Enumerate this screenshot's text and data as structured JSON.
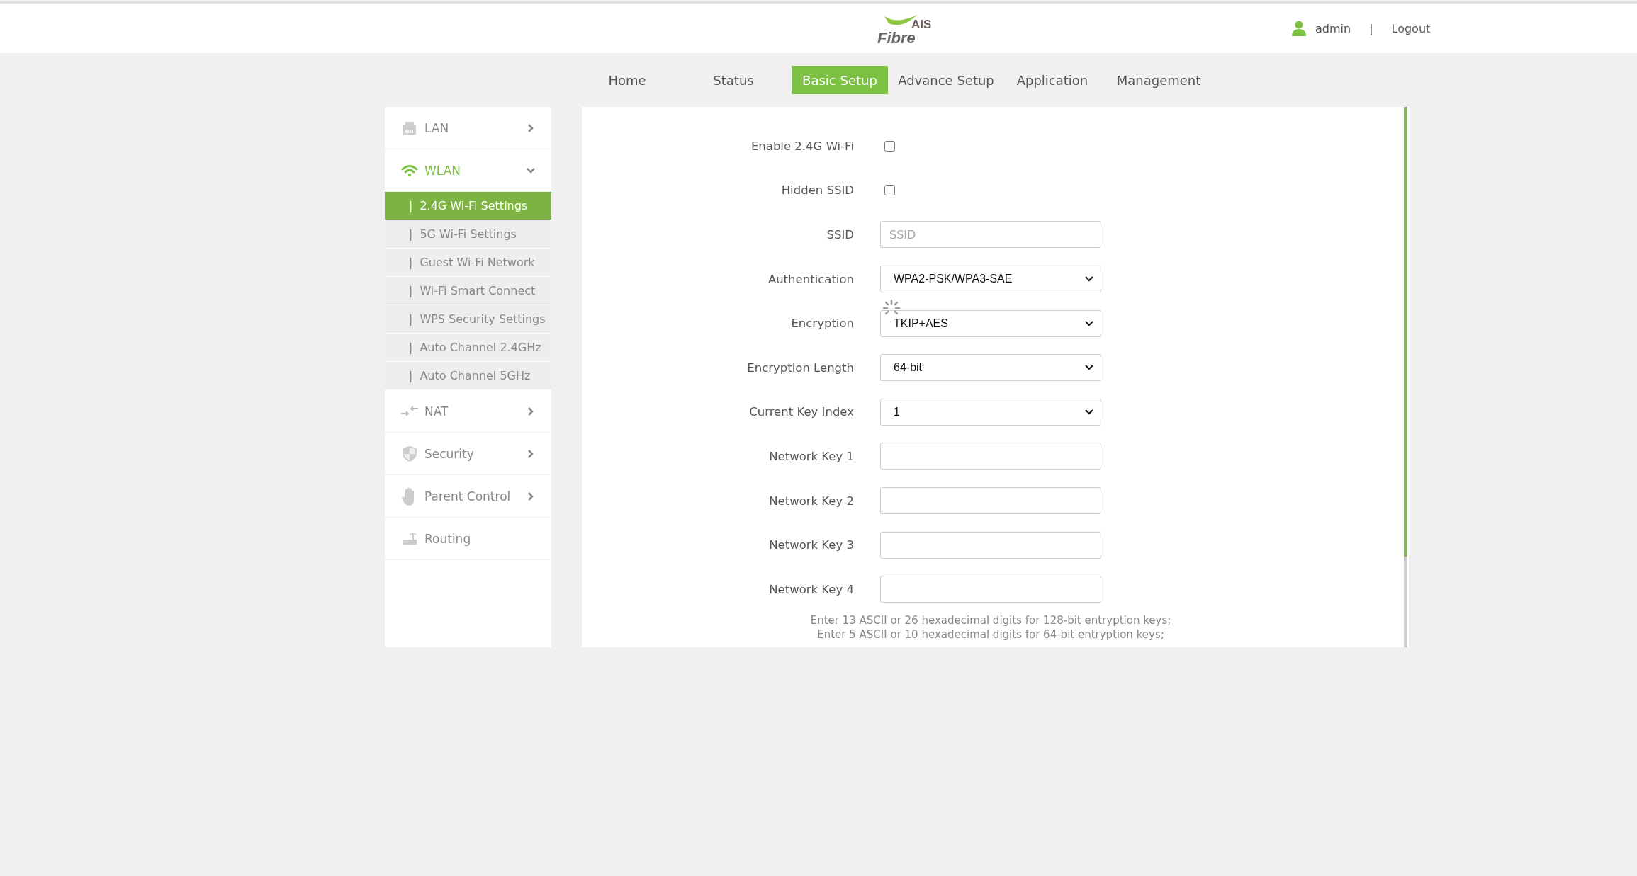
{
  "header": {
    "logo": {
      "top": "AIS",
      "bottom": "Fibre"
    },
    "user": "admin",
    "separator": "|",
    "logout": "Logout"
  },
  "nav": [
    {
      "label": "Home",
      "selected": false
    },
    {
      "label": "Status",
      "selected": false
    },
    {
      "label": "Basic Setup",
      "selected": true
    },
    {
      "label": "Advance Setup",
      "selected": false
    },
    {
      "label": "Application",
      "selected": false
    },
    {
      "label": "Management",
      "selected": false
    }
  ],
  "sidebar": {
    "items": [
      {
        "label": "LAN",
        "expandable": true,
        "expanded": false
      },
      {
        "label": "WLAN",
        "expandable": true,
        "expanded": true,
        "children": [
          {
            "marker": "|",
            "label": "2.4G Wi-Fi Settings",
            "selected": true
          },
          {
            "marker": "|",
            "label": "5G Wi-Fi Settings",
            "selected": false
          },
          {
            "marker": "|",
            "label": "Guest Wi-Fi Network",
            "selected": false
          },
          {
            "marker": "|",
            "label": "Wi-Fi Smart Connect",
            "selected": false
          },
          {
            "marker": "|",
            "label": "WPS Security Settings",
            "selected": false
          },
          {
            "marker": "|",
            "label": "Auto Channel 2.4GHz",
            "selected": false
          },
          {
            "marker": "|",
            "label": "Auto Channel 5GHz",
            "selected": false
          }
        ]
      },
      {
        "label": "NAT",
        "expandable": true,
        "expanded": false
      },
      {
        "label": "Security",
        "expandable": true,
        "expanded": false
      },
      {
        "label": "Parent Control",
        "expandable": true,
        "expanded": false
      },
      {
        "label": "Routing",
        "expandable": false,
        "expanded": false
      }
    ]
  },
  "form": {
    "fields": [
      {
        "kind": "checkbox",
        "label": "Enable 2.4G Wi-Fi",
        "checked": false
      },
      {
        "kind": "checkbox",
        "label": "Hidden SSID",
        "checked": false
      },
      {
        "kind": "text",
        "label": "SSID",
        "placeholder": "SSID"
      },
      {
        "kind": "select",
        "label": "Authentication",
        "value": "WPA2-PSK/WPA3-SAE"
      },
      {
        "kind": "select",
        "label": "Encryption",
        "value": "TKIP+AES"
      },
      {
        "kind": "select",
        "label": "Encryption Length",
        "value": "64-bit"
      },
      {
        "kind": "select",
        "label": "Current Key Index",
        "value": "1"
      },
      {
        "kind": "text",
        "label": "Network Key 1"
      },
      {
        "kind": "text",
        "label": "Network Key 2"
      },
      {
        "kind": "text",
        "label": "Network Key 3"
      },
      {
        "kind": "text",
        "label": "Network Key 4"
      }
    ],
    "hints": [
      "Enter 13 ASCII or 26 hexadecimal digits for 128-bit entryption keys;",
      "Enter 5 ASCII or 10 hexadecimal digits for 64-bit entryption keys;"
    ]
  }
}
